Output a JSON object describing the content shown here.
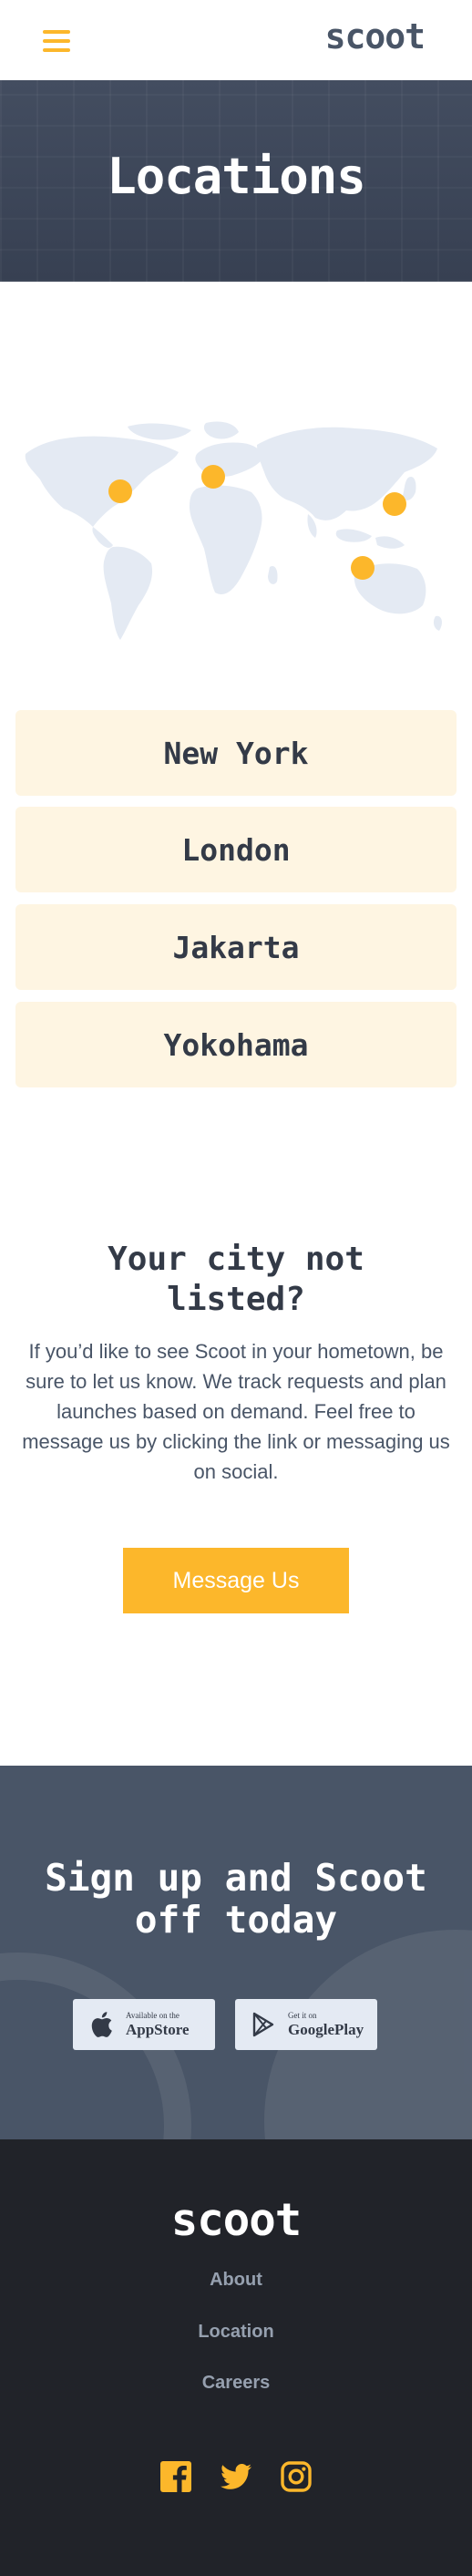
{
  "header": {
    "logo": "scoot",
    "menu_icon": "hamburger-menu-icon"
  },
  "hero": {
    "title": "Locations"
  },
  "map": {
    "icon": "world-map",
    "marker_color": "#fcb72b"
  },
  "locations": [
    {
      "label": "New York"
    },
    {
      "label": "London"
    },
    {
      "label": "Jakarta"
    },
    {
      "label": "Yokohama"
    }
  ],
  "cta": {
    "title": "Your city not listed?",
    "text": "If you’d like to see Scoot in your hometown, be sure to let us know. We track requests and plan launches based on demand. Feel free to message us by clicking the link or messaging us on social.",
    "button": "Message Us"
  },
  "signup": {
    "title": "Sign up and Scoot off today",
    "appstore": {
      "small": "Available on the",
      "big": "AppStore",
      "icon": "apple-icon"
    },
    "googleplay": {
      "small": "Get it on",
      "big": "GooglePlay",
      "icon": "google-play-icon"
    }
  },
  "footer": {
    "logo": "scoot",
    "links": [
      "About",
      "Location",
      "Careers"
    ],
    "social": [
      "facebook-icon",
      "twitter-icon",
      "instagram-icon"
    ]
  },
  "colors": {
    "accent": "#fcb72b",
    "dark": "#212329",
    "slate": "#495567",
    "card_bg": "#fef5e2"
  }
}
